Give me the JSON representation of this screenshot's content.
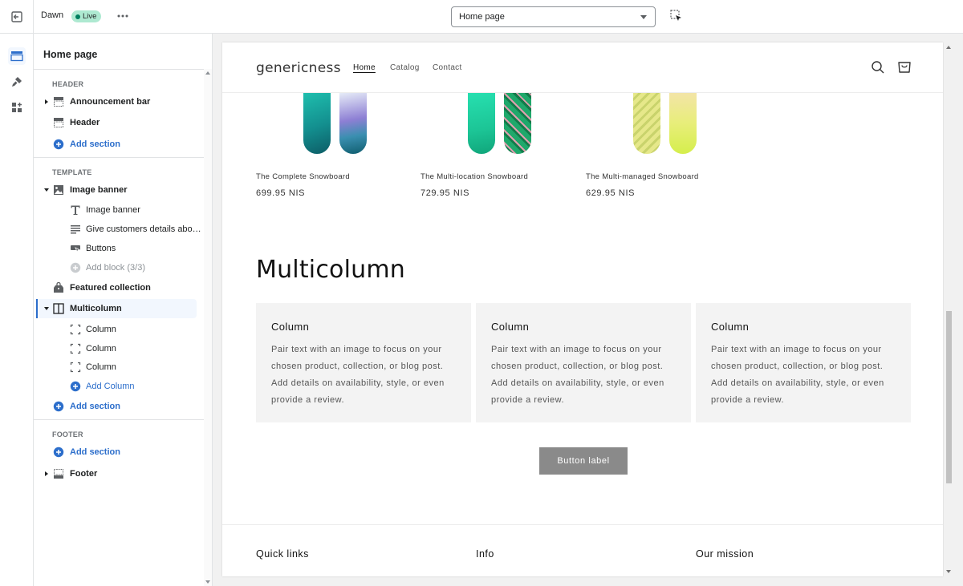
{
  "topbar": {
    "theme_name": "Dawn",
    "live_badge": "Live",
    "page_select_value": "Home page"
  },
  "rail": {
    "items": [
      {
        "icon": "sections-icon",
        "active": true
      },
      {
        "icon": "theme-settings-icon",
        "active": false
      },
      {
        "icon": "app-embeds-icon",
        "active": false
      }
    ]
  },
  "sidebar": {
    "title": "Home page",
    "header_group": {
      "label": "HEADER",
      "announcement_bar": "Announcement bar",
      "header": "Header",
      "add_section": "Add section"
    },
    "template_group": {
      "label": "TEMPLATE",
      "image_banner": "Image banner",
      "image_banner_blocks": [
        "Image banner",
        "Give customers details abo…",
        "Buttons"
      ],
      "add_block": "Add block (3/3)",
      "featured_collection": "Featured collection",
      "multicolumn": "Multicolumn",
      "multicolumn_blocks": [
        "Column",
        "Column",
        "Column"
      ],
      "add_column": "Add Column",
      "add_section": "Add section"
    },
    "footer_group": {
      "label": "FOOTER",
      "add_section": "Add section",
      "footer": "Footer"
    }
  },
  "store": {
    "logo": "genericness",
    "nav": [
      "Home",
      "Catalog",
      "Contact"
    ],
    "products": [
      {
        "title": "The Complete Snowboard",
        "price": "699.95 NIS"
      },
      {
        "title": "The Multi-location Snowboard",
        "price": "729.95 NIS"
      },
      {
        "title": "The Multi-managed Snowboard",
        "price": "629.95 NIS"
      }
    ],
    "multicolumn": {
      "heading": "Multicolumn",
      "columns": [
        {
          "title": "Column",
          "text": "Pair text with an image to focus on your chosen product, collection, or blog post. Add details on availability, style, or even provide a review."
        },
        {
          "title": "Column",
          "text": "Pair text with an image to focus on your chosen product, collection, or blog post. Add details on availability, style, or even provide a review."
        },
        {
          "title": "Column",
          "text": "Pair text with an image to focus on your chosen product, collection, or blog post. Add details on availability, style, or even provide a review."
        }
      ],
      "button_label": "Button label"
    },
    "footer_headings": [
      "Quick links",
      "Info",
      "Our mission"
    ]
  },
  "colors": {
    "accent_blue": "#2c6ecb",
    "live_badge_bg": "#aee9d1",
    "button_gray": "#8a8a8a",
    "column_bg": "#f3f3f3"
  }
}
